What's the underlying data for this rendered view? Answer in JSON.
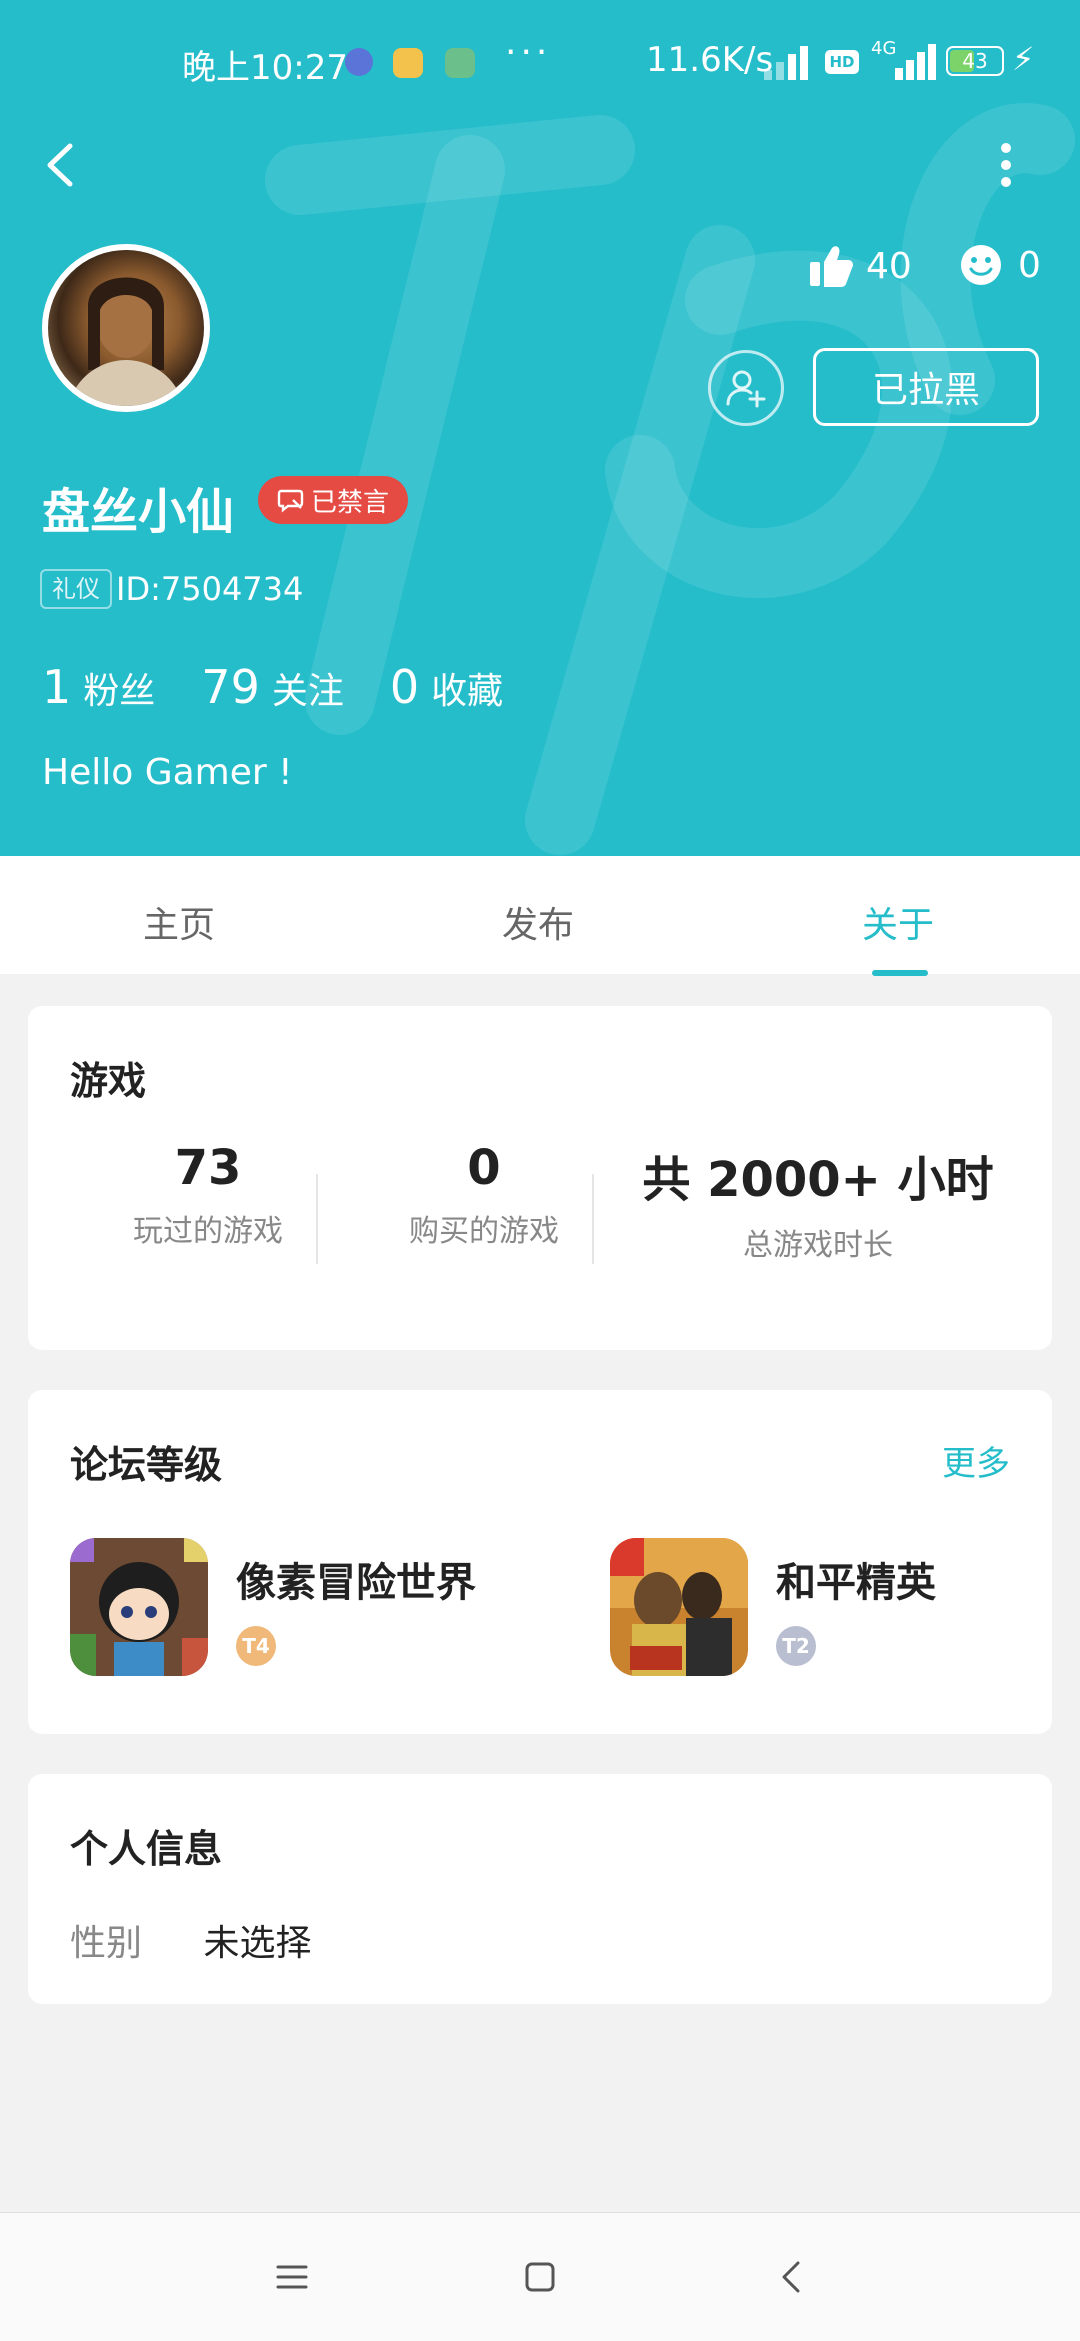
{
  "status_bar": {
    "time": "晚上10:27",
    "dots": "···",
    "net_speed": "11.6K/s",
    "hd": "HD",
    "network": "4G",
    "battery": "43",
    "charging_icon": "bolt-icon"
  },
  "profile": {
    "username": "盘丝小仙",
    "mute_badge": "已禁言",
    "tag": "礼仪",
    "uid": "ID:7504734",
    "likes": "40",
    "smiles": "0",
    "blocked_label": "已拉黑",
    "followers_count": "1",
    "followers_label": "粉丝",
    "following_count": "79",
    "following_label": "关注",
    "favorites_count": "0",
    "favorites_label": "收藏",
    "bio": "Hello Gamer !"
  },
  "tabs": [
    {
      "label": "主页"
    },
    {
      "label": "发布"
    },
    {
      "label": "关于"
    }
  ],
  "active_tab": "关于",
  "games_card": {
    "title": "游戏",
    "stats": [
      {
        "value": "73",
        "label": "玩过的游戏"
      },
      {
        "value": "0",
        "label": "购买的游戏"
      },
      {
        "value": "共 2000+ 小时",
        "label": "总游戏时长"
      }
    ]
  },
  "forum_card": {
    "title": "论坛等级",
    "more": "更多",
    "games": [
      {
        "name": "像素冒险世界",
        "level": "T4",
        "badge_color": "#f0b97a"
      },
      {
        "name": "和平精英",
        "level": "T2",
        "badge_color": "#b9bfd0"
      }
    ]
  },
  "info_card": {
    "title": "个人信息",
    "gender_label": "性别",
    "gender_value": "未选择"
  },
  "colors": {
    "accent": "#26bdcb",
    "mute_badge": "#e54a43"
  }
}
